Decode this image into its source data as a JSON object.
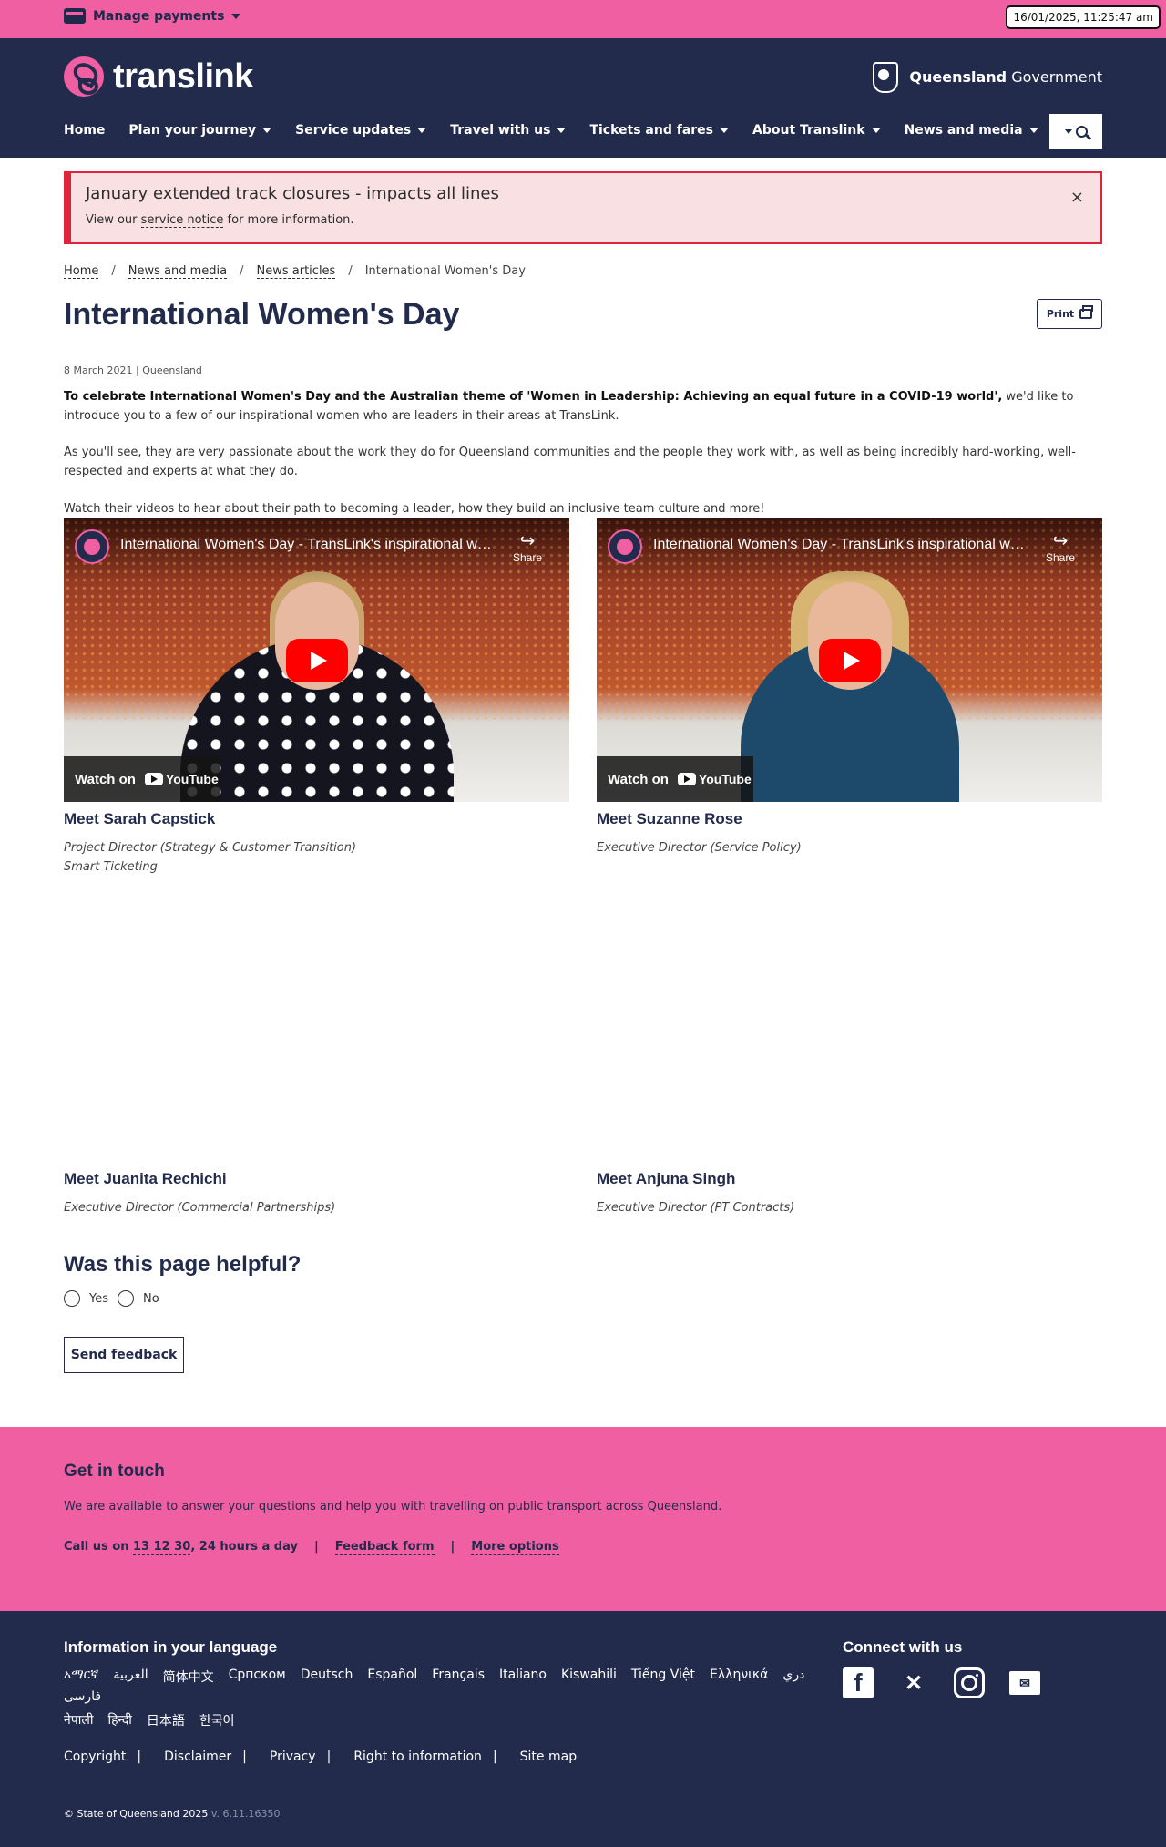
{
  "topbar": {
    "manage_label": "Manage payments",
    "clock": "16/01/2025, 11:25:47 am",
    "bg_color": "#ef5fa1"
  },
  "header": {
    "logo_text": "translink",
    "gov_bold": "Queensland",
    "gov_rest": " Government",
    "bg_color": "#232b4d",
    "nav": [
      {
        "label": "Home",
        "has_menu": false
      },
      {
        "label": "Plan your journey",
        "has_menu": true
      },
      {
        "label": "Service updates",
        "has_menu": true
      },
      {
        "label": "Travel with us",
        "has_menu": true
      },
      {
        "label": "Tickets and fares",
        "has_menu": true
      },
      {
        "label": "About Translink",
        "has_menu": true
      },
      {
        "label": "News and media",
        "has_menu": true
      }
    ]
  },
  "alert": {
    "title": "January extended track closures - impacts all lines",
    "body_before": "View our ",
    "link": "service notice",
    "body_after": " for more information.",
    "close": "×"
  },
  "breadcrumb": [
    {
      "label": "Home",
      "link": true
    },
    {
      "label": "News and media",
      "link": true
    },
    {
      "label": "News articles",
      "link": true
    },
    {
      "label": "International Women's Day",
      "link": false
    }
  ],
  "page": {
    "title": "International Women's Day",
    "print_label": "Print",
    "meta": "8 March 2021 | Queensland",
    "intro_bold": "To celebrate International Women's Day and the Australian theme of 'Women in Leadership: Achieving an equal future in a COVID-19 world',",
    "intro_rest": " we'd like to introduce you to a few of our inspirational women who are leaders in their areas at TransLink.",
    "para2": "As you'll see, they are very passionate about the work they do for Queensland communities and the people they work with, as well as being incredibly hard-working, well-respected and experts at what they do.",
    "para3": "Watch their videos to hear about their path to becoming a leader, how they build an inclusive team culture and more!"
  },
  "videos": [
    {
      "title": "International Women's Day - TransLink's inspirational women",
      "share": "Share",
      "watch_on": "Watch on",
      "yt": "YouTube",
      "name": "Meet Sarah Capstick",
      "role_line1": "Project Director (Strategy & Customer Transition)",
      "role_line2": "Smart Ticketing"
    },
    {
      "title": "International Women's Day - TransLink's inspirational women",
      "share": "Share",
      "watch_on": "Watch on",
      "yt": "YouTube",
      "name": "Meet Suzanne Rose",
      "role_line1": "Executive Director (Service Policy)",
      "role_line2": ""
    },
    {
      "name": "Meet Juanita Rechichi",
      "role_line1": "Executive Director (Commercial Partnerships)"
    },
    {
      "name": "Meet Anjuna Singh",
      "role_line1": "Executive Director (PT Contracts)"
    }
  ],
  "feedback": {
    "heading": "Was this page helpful?",
    "yes": "Yes",
    "no": "No",
    "send": "Send feedback"
  },
  "touch": {
    "heading": "Get in touch",
    "text": "We are available to answer your questions and help you with travelling on public transport across Queensland.",
    "call_prefix": "Call us on ",
    "phone": "13 12 30",
    "call_suffix": ", 24 hours a day",
    "sep": "|",
    "feedback_form": "Feedback form",
    "more_options": "More options"
  },
  "footer": {
    "lang_heading": "Information in your language",
    "languages": [
      "አማርኛ",
      "العربية",
      "简体中文",
      "Српском",
      "Deutsch",
      "Español",
      "Français",
      "Italiano",
      "Kiswahili",
      "Tiếng Việt",
      "Ελληνικά",
      "دري",
      "فارسی",
      "नेपाली",
      "हिन्दी",
      "日本語",
      "한국어"
    ],
    "connect_heading": "Connect with us",
    "social_icons": [
      "facebook-icon",
      "x-icon",
      "instagram-icon",
      "email-icon"
    ],
    "links": [
      "Copyright",
      "Disclaimer",
      "Privacy",
      "Right to information",
      "Site map"
    ],
    "sep": "|",
    "copyright": "© State of Queensland 2025",
    "version": " v. 6.11.16350"
  }
}
